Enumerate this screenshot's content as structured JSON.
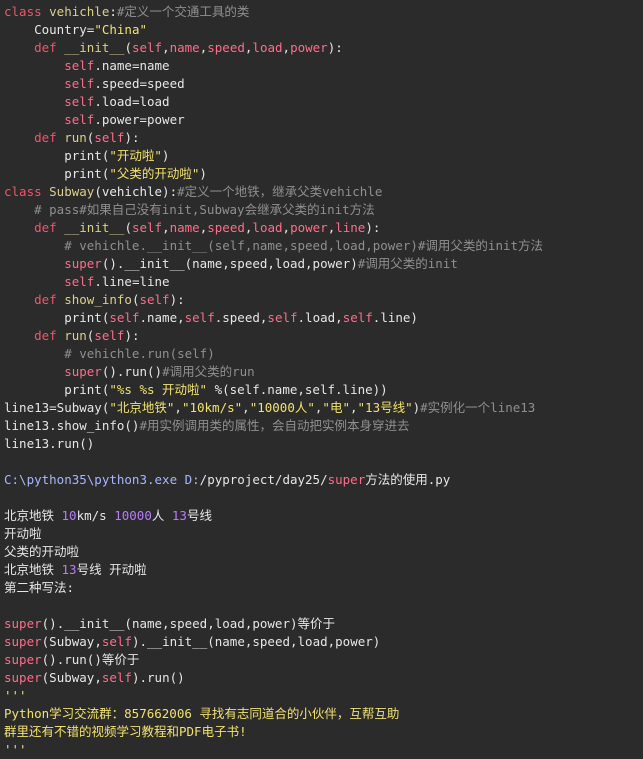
{
  "lines": [
    [
      [
        "kw",
        "class "
      ],
      [
        "fn",
        "vehichle"
      ],
      [
        "wt",
        ":"
      ],
      [
        "cmt",
        "#定义一个交通工具的类"
      ]
    ],
    [
      [
        "wt",
        "    Country="
      ],
      [
        "str",
        "\"China\""
      ]
    ],
    [
      [
        "kw",
        "    def "
      ],
      [
        "fn",
        "__init__"
      ],
      [
        "wt",
        "("
      ],
      [
        "self",
        "self"
      ],
      [
        "wt",
        ","
      ],
      [
        "self",
        "name"
      ],
      [
        "wt",
        ","
      ],
      [
        "self",
        "speed"
      ],
      [
        "wt",
        ","
      ],
      [
        "self",
        "load"
      ],
      [
        "wt",
        ","
      ],
      [
        "self",
        "power"
      ],
      [
        "wt",
        "):"
      ]
    ],
    [
      [
        "self",
        "        self"
      ],
      [
        "wt",
        ".name=name"
      ]
    ],
    [
      [
        "self",
        "        self"
      ],
      [
        "wt",
        ".speed=speed"
      ]
    ],
    [
      [
        "self",
        "        self"
      ],
      [
        "wt",
        ".load=load"
      ]
    ],
    [
      [
        "self",
        "        self"
      ],
      [
        "wt",
        ".power=power"
      ]
    ],
    [
      [
        "kw",
        "    def "
      ],
      [
        "fn",
        "run"
      ],
      [
        "wt",
        "("
      ],
      [
        "self",
        "self"
      ],
      [
        "wt",
        "):"
      ]
    ],
    [
      [
        "wt",
        "        print("
      ],
      [
        "str",
        "\"开动啦\""
      ],
      [
        "wt",
        ")"
      ]
    ],
    [
      [
        "wt",
        "        print("
      ],
      [
        "str",
        "\"父类的开动啦\""
      ],
      [
        "wt",
        ")"
      ]
    ],
    [
      [
        "kw",
        "class "
      ],
      [
        "fn",
        "Subway"
      ],
      [
        "wt",
        "(vehichle):"
      ],
      [
        "cmt",
        "#定义一个地铁，继承父类vehichle"
      ]
    ],
    [
      [
        "cmt",
        "    # pass#如果自己没有init,Subway会继承父类的init方法"
      ]
    ],
    [
      [
        "kw",
        "    def "
      ],
      [
        "fn",
        "__init__"
      ],
      [
        "wt",
        "("
      ],
      [
        "self",
        "self"
      ],
      [
        "wt",
        ","
      ],
      [
        "self",
        "name"
      ],
      [
        "wt",
        ","
      ],
      [
        "self",
        "speed"
      ],
      [
        "wt",
        ","
      ],
      [
        "self",
        "load"
      ],
      [
        "wt",
        ","
      ],
      [
        "self",
        "power"
      ],
      [
        "wt",
        ","
      ],
      [
        "self",
        "line"
      ],
      [
        "wt",
        "):"
      ]
    ],
    [
      [
        "cmt",
        "        # vehichle.__init__(self,name,speed,load,power)#调用父类的init方法"
      ]
    ],
    [
      [
        "self",
        "        super"
      ],
      [
        "wt",
        "().__init__(name,speed,load,power)"
      ],
      [
        "cmt",
        "#调用父类的init"
      ]
    ],
    [
      [
        "self",
        "        self"
      ],
      [
        "wt",
        ".line=line"
      ]
    ],
    [
      [
        "kw",
        "    def "
      ],
      [
        "fn",
        "show_info"
      ],
      [
        "wt",
        "("
      ],
      [
        "self",
        "self"
      ],
      [
        "wt",
        "):"
      ]
    ],
    [
      [
        "wt",
        "        print("
      ],
      [
        "self",
        "self"
      ],
      [
        "wt",
        ".name,"
      ],
      [
        "self",
        "self"
      ],
      [
        "wt",
        ".speed,"
      ],
      [
        "self",
        "self"
      ],
      [
        "wt",
        ".load,"
      ],
      [
        "self",
        "self"
      ],
      [
        "wt",
        ".line)"
      ]
    ],
    [
      [
        "kw",
        "    def "
      ],
      [
        "fn",
        "run"
      ],
      [
        "wt",
        "("
      ],
      [
        "self",
        "self"
      ],
      [
        "wt",
        "):"
      ]
    ],
    [
      [
        "cmt",
        "        # vehichle.run(self)"
      ]
    ],
    [
      [
        "self",
        "        super"
      ],
      [
        "wt",
        "().run()"
      ],
      [
        "cmt",
        "#调用父类的run"
      ]
    ],
    [
      [
        "wt",
        "        print("
      ],
      [
        "str",
        "\"%s %s 开动啦\""
      ],
      [
        "wt",
        " %(self.name,self.line))"
      ]
    ],
    [
      [
        "wt",
        "line13=Subway("
      ],
      [
        "str",
        "\"北京地铁\""
      ],
      [
        "wt",
        ","
      ],
      [
        "str",
        "\"10km/s\""
      ],
      [
        "wt",
        ","
      ],
      [
        "str",
        "\"10000人\""
      ],
      [
        "wt",
        ","
      ],
      [
        "str",
        "\"电\""
      ],
      [
        "wt",
        ","
      ],
      [
        "str",
        "\"13号线\""
      ],
      [
        "wt",
        ")"
      ],
      [
        "cmt",
        "#实例化一个line13"
      ]
    ],
    [
      [
        "wt",
        "line13.show_info()"
      ],
      [
        "cmt",
        "#用实例调用类的属性，会自动把实例本身穿进去"
      ]
    ],
    [
      [
        "wt",
        "line13.run()"
      ]
    ],
    [],
    [
      [
        "path",
        "C:\\python35\\python3.exe D:"
      ],
      [
        "wt",
        "/pyproject/day25/"
      ],
      [
        "self",
        "super"
      ],
      [
        "wt",
        "方法的使用.py"
      ]
    ],
    [],
    [
      [
        "wt",
        "北京地铁 "
      ],
      [
        "num",
        "10"
      ],
      [
        "wt",
        "km/s "
      ],
      [
        "num",
        "10000"
      ],
      [
        "wt",
        "人 "
      ],
      [
        "num",
        "13"
      ],
      [
        "wt",
        "号线"
      ]
    ],
    [
      [
        "wt",
        "开动啦"
      ]
    ],
    [
      [
        "wt",
        "父类的开动啦"
      ]
    ],
    [
      [
        "wt",
        "北京地铁 "
      ],
      [
        "num",
        "13"
      ],
      [
        "wt",
        "号线 开动啦"
      ]
    ],
    [
      [
        "wt",
        "第二种写法:"
      ]
    ],
    [],
    [
      [
        "self",
        "super"
      ],
      [
        "wt",
        "().__init__(name,speed,load,power)等价于"
      ]
    ],
    [
      [
        "self",
        "super"
      ],
      [
        "wt",
        "(Subway,"
      ],
      [
        "self",
        "self"
      ],
      [
        "wt",
        ").__init__(name,speed,load,power)"
      ]
    ],
    [
      [
        "self",
        "super"
      ],
      [
        "wt",
        "().run()等价于"
      ]
    ],
    [
      [
        "self",
        "super"
      ],
      [
        "wt",
        "(Subway,"
      ],
      [
        "self",
        "self"
      ],
      [
        "wt",
        ").run()"
      ]
    ],
    [
      [
        "str",
        "'''"
      ]
    ],
    [
      [
        "str",
        "Python学习交流群：857662006 寻找有志同道合的小伙伴，互帮互助"
      ]
    ],
    [
      [
        "str",
        "群里还有不错的视频学习教程和PDF电子书!"
      ]
    ],
    [
      [
        "str",
        "'''"
      ]
    ]
  ]
}
